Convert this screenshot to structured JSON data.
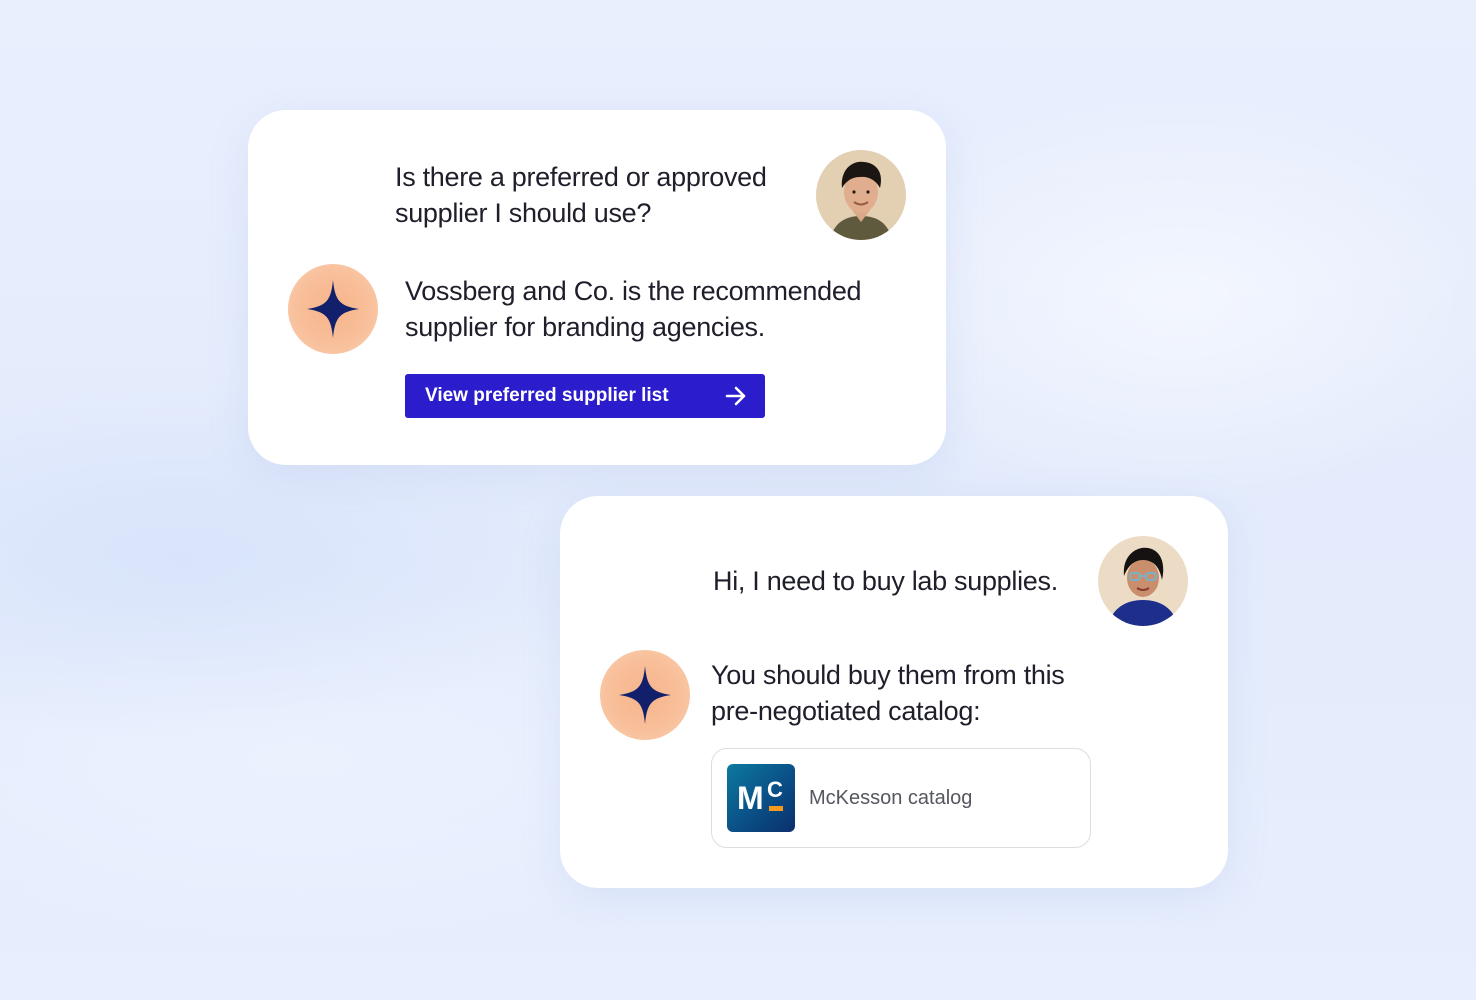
{
  "conversation_1": {
    "user_message": "Is there a preferred or approved supplier I should use?",
    "user_message_lines": [
      "Is there a preferred or approved",
      "supplier I should use?"
    ],
    "assistant_message_lines": [
      "Vossberg and Co. is the recommended",
      "supplier for branding agencies."
    ],
    "action_button_label": "View preferred supplier list"
  },
  "conversation_2": {
    "user_message": "Hi, I need to buy lab supplies.",
    "assistant_message_lines": [
      "You should buy them from this",
      "pre-negotiated catalog:"
    ],
    "catalog": {
      "label": "McKesson catalog",
      "logo_text_m": "M",
      "logo_text_c": "C"
    }
  },
  "icons": {
    "assistant": "sparkle-icon",
    "button_arrow": "arrow-right-icon"
  },
  "colors": {
    "button": "#2b1ccc",
    "assistant_avatar_bg": "#f6b48a",
    "sparkle": "#12206b",
    "catalog_logo": "#0a4f86",
    "catalog_logo_accent": "#f39a1f"
  }
}
